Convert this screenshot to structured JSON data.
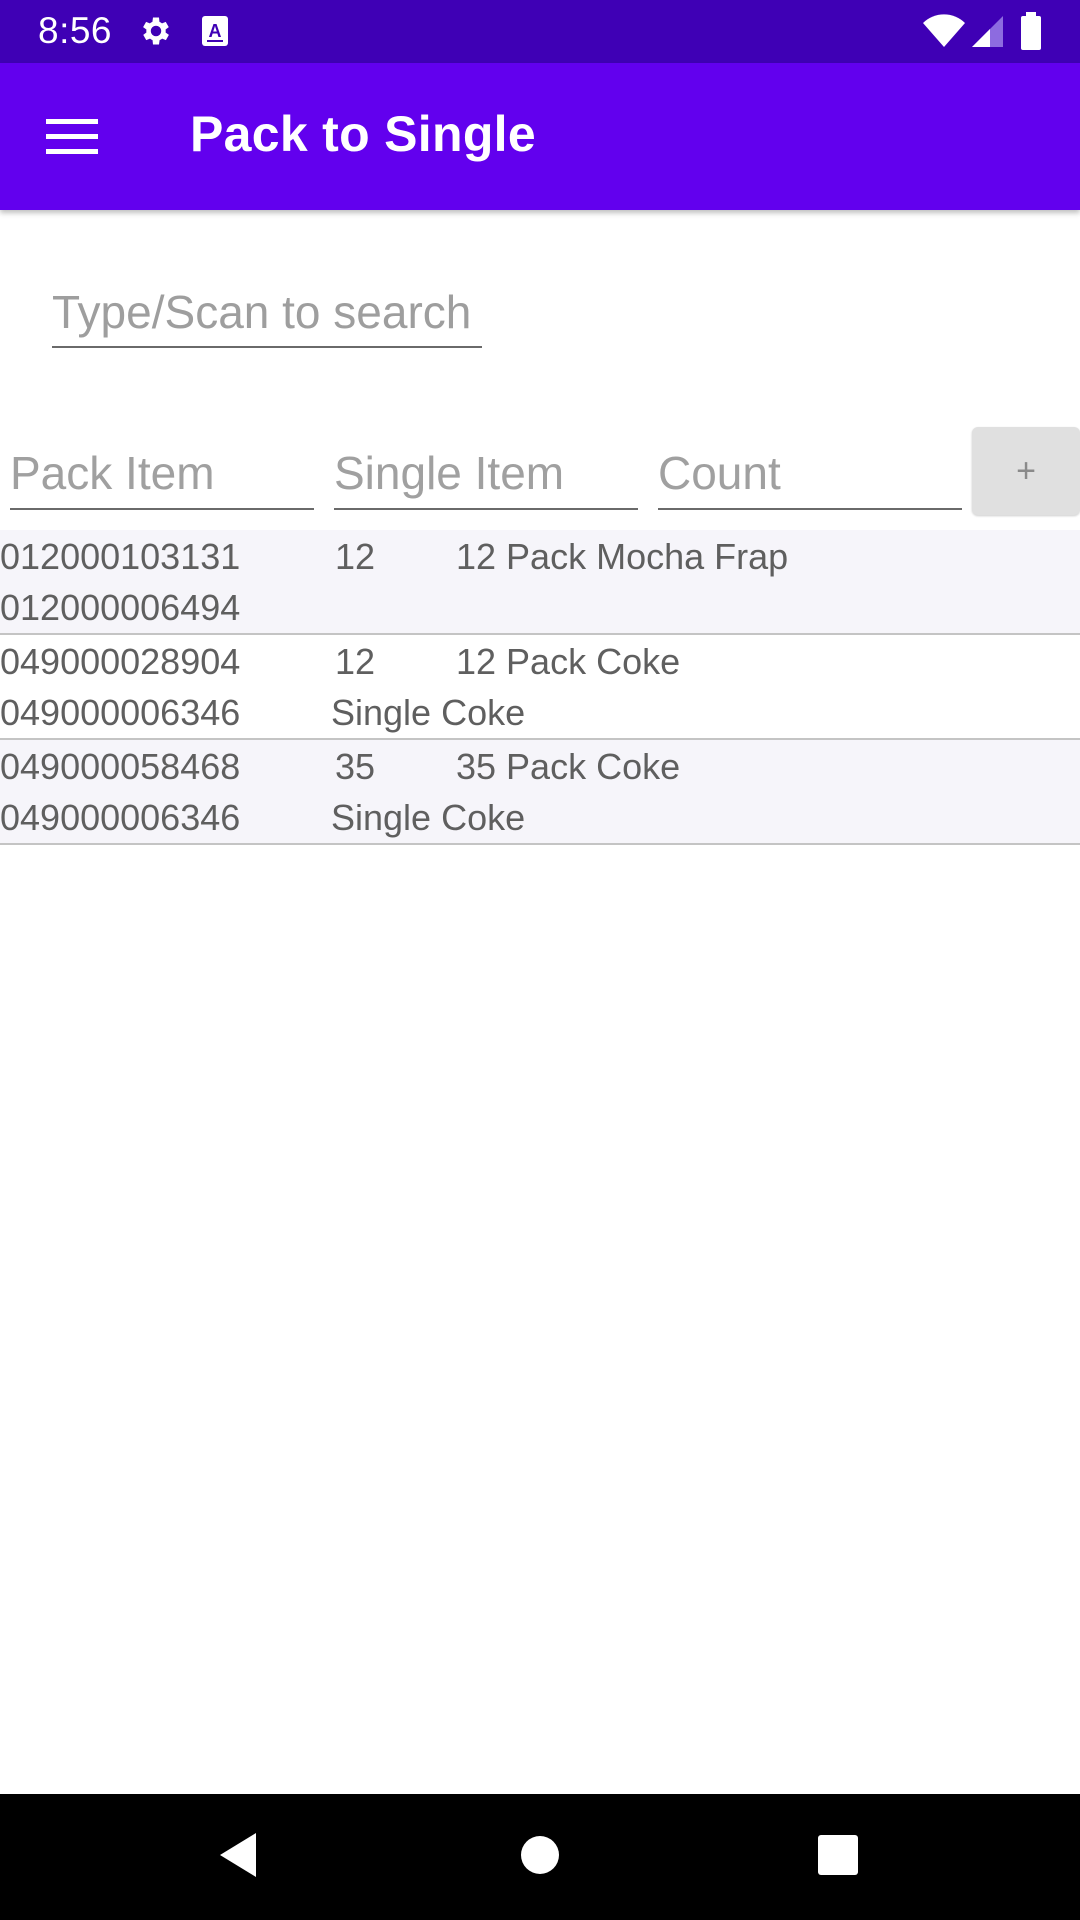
{
  "status_bar": {
    "time": "8:56",
    "icons": [
      "gear-icon",
      "keyboard-a-icon",
      "wifi-icon",
      "signal-icon",
      "battery-icon"
    ],
    "background": "#3f00b5"
  },
  "app_bar": {
    "title": "Pack to Single",
    "menu_icon": "hamburger-menu-icon",
    "background": "#6200ee"
  },
  "search": {
    "placeholder": "Type/Scan to search",
    "value": ""
  },
  "form": {
    "pack_item_placeholder": "Pack Item",
    "single_item_placeholder": "Single Item",
    "count_placeholder": "Count",
    "add_label": "+"
  },
  "rows": [
    {
      "pack_upc": "012000103131",
      "count": "12",
      "pack_desc": "12 Pack Mocha Frap",
      "single_upc": "012000006494",
      "single_desc": ""
    },
    {
      "pack_upc": "049000028904",
      "count": "12",
      "pack_desc": "12 Pack Coke",
      "single_upc": "049000006346",
      "single_desc": "Single Coke"
    },
    {
      "pack_upc": "049000058468",
      "count": "35",
      "pack_desc": "35 Pack Coke",
      "single_upc": "049000006346",
      "single_desc": "Single Coke"
    }
  ],
  "nav_bar": {
    "icons": [
      "back-icon",
      "home-icon",
      "recents-icon"
    ]
  }
}
